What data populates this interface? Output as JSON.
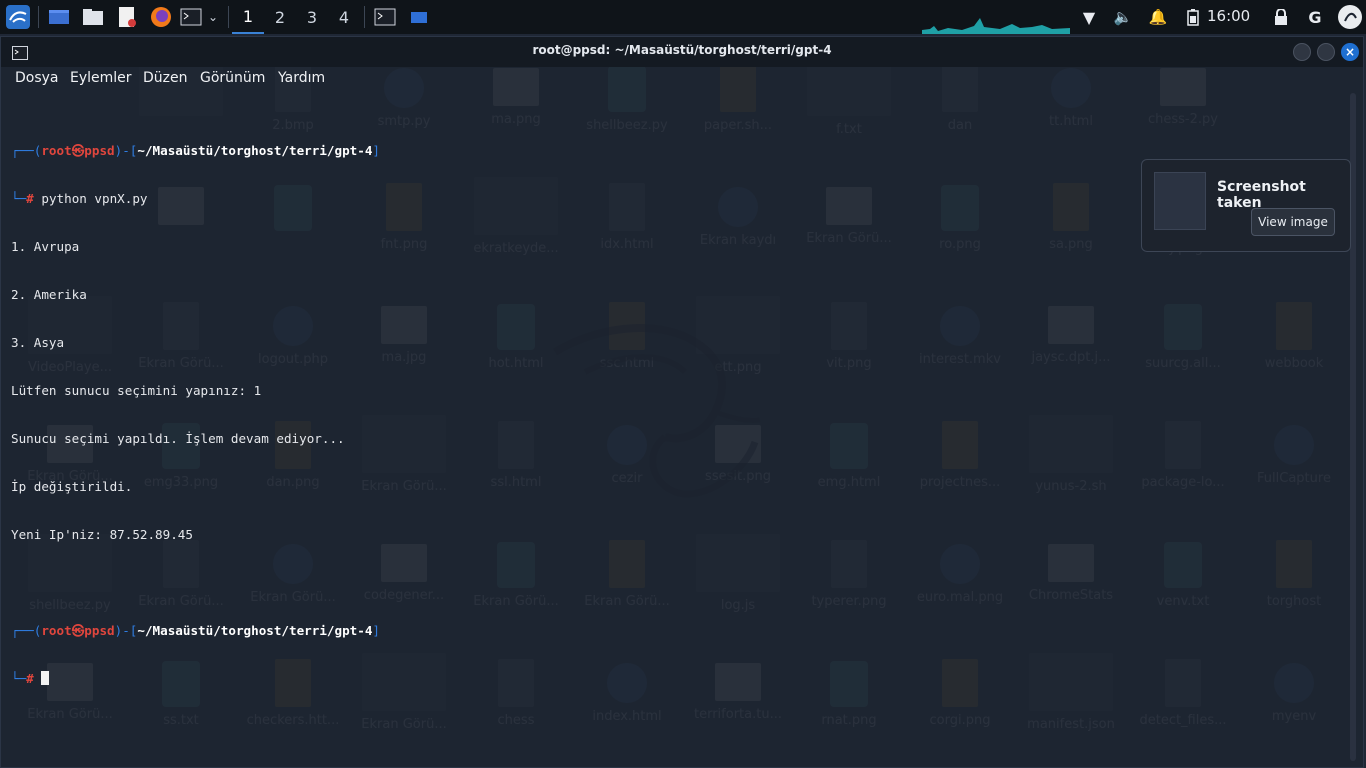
{
  "panel": {
    "workspaces": [
      "1",
      "2",
      "3",
      "4"
    ],
    "active_workspace": "1",
    "clock": "16:00"
  },
  "terminal": {
    "title": "root@ppsd: ~/Masaüstü/torghost/terri/gpt-4",
    "menu": [
      "Dosya",
      "Eylemler",
      "Düzen",
      "Görünüm",
      "Yardım"
    ],
    "prompt": {
      "user": "root",
      "host": "ppsd",
      "path": "~/Masaüstü/torghost/terri/gpt-4",
      "symbol": "#"
    },
    "command": "python vpnX.py",
    "output": [
      "1. Avrupa",
      "2. Amerika",
      "3. Asya",
      "Lütfen sunucu seçimini yapınız: 1",
      "Sunucu seçimi yapıldı. İşlem devam ediyor...",
      "İp değiştirildi.",
      "Yeni Ip'niz: 87.52.89.45"
    ]
  },
  "notification": {
    "title": "Screenshot taken",
    "button": "View image"
  },
  "desktop": {
    "icons": [
      [
        "",
        "2.bmp",
        "smtp.py",
        "ma.png",
        "shellbeez.py",
        "paper.sh...",
        "f.txt",
        "dan",
        "tt.html",
        "chess-2.py"
      ],
      [
        "",
        "",
        "fnt.png",
        "ekratkeyde...",
        "idx.html",
        "Ekran kaydı",
        "Ekran Görü...",
        "ro.png",
        "sa.png",
        "ty.png"
      ],
      [
        "VideoPlaye...",
        "Ekran Görü...",
        "logout.php",
        "ma.jpg",
        "hot.html",
        "ssc.html",
        "ett.png",
        "vit.png",
        "interest.mkv",
        "jaysc.dpt.j...",
        "suurcg.all...",
        "webbook"
      ],
      [
        "Ekran Görü...",
        "emg33.png",
        "dan.png",
        "Ekran Görü...",
        "ssl.html",
        "cezir",
        "ssesit.png",
        "emg.html",
        "projectnes...",
        "yunus-2.sh",
        "package-lo...",
        "FullCapture"
      ],
      [
        "shellbeez.py",
        "Ekran Görü...",
        "Ekran Görü...",
        "codegener...",
        "Ekran Görü...",
        "Ekran Görü...",
        "log.js",
        "typerer.png",
        "euro.mal.png",
        "ChromeStats",
        "venv.txt",
        "torghost"
      ],
      [
        "Ekran Görü...",
        "ss.txt",
        "checkers.htt...",
        "Ekran Görü...",
        "chess",
        "index.html",
        "terriforta.tu...",
        "rnat.png",
        "corgi.png",
        "manifest.json",
        "detect_files...",
        "myenv"
      ]
    ]
  }
}
